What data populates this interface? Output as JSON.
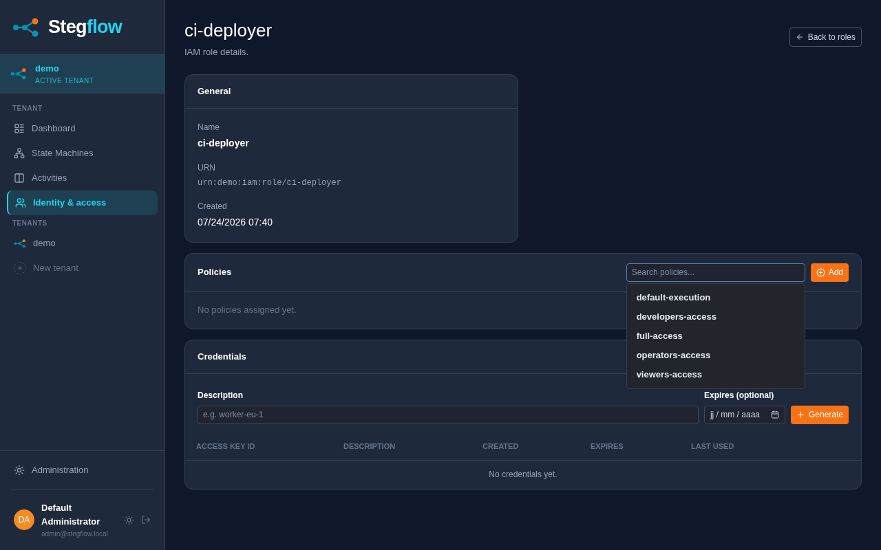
{
  "brand": {
    "first": "Steg",
    "second": "flow"
  },
  "active_tenant": {
    "name": "demo",
    "label": "ACTIVE TENANT"
  },
  "nav_sections": [
    {
      "title": "TENANT",
      "items": [
        {
          "label": "Dashboard",
          "kind": "dashboard",
          "selected": false
        },
        {
          "label": "State Machines",
          "kind": "machines",
          "selected": false
        },
        {
          "label": "Activities",
          "kind": "activities",
          "selected": false
        },
        {
          "label": "Identity & access",
          "kind": "identity",
          "selected": true
        }
      ]
    },
    {
      "title": "TENANTS",
      "items": [
        {
          "label": "demo",
          "kind": "tenant",
          "selected": false
        },
        {
          "label": "New tenant",
          "kind": "new",
          "selected": false
        }
      ]
    }
  ],
  "admin_link": "Administration",
  "user": {
    "initials": "DA",
    "name": "Default Administrator",
    "email": "admin@stegflow.local"
  },
  "page": {
    "title": "ci-deployer",
    "subtitle": "IAM role details.",
    "back": "Back to roles"
  },
  "general": {
    "title": "General",
    "fields": [
      {
        "label": "Name",
        "value": "ci-deployer",
        "kind": "bold"
      },
      {
        "label": "URN",
        "value": "urn:demo:iam:role/ci-deployer",
        "kind": "code"
      },
      {
        "label": "Created",
        "value": "07/24/2026 07:40",
        "kind": "plain"
      }
    ]
  },
  "policies": {
    "title": "Policies",
    "search_placeholder": "Search policies...",
    "add": "Add",
    "empty": "No policies assigned yet.",
    "options": [
      "default-execution",
      "developers-access",
      "full-access",
      "operators-access",
      "viewers-access"
    ]
  },
  "credentials": {
    "title": "Credentials",
    "description_label": "Description",
    "description_placeholder": "e.g. worker-eu-1",
    "expires_label": "Expires (optional)",
    "date_placeholder": "jj / mm / aaaa",
    "generate": "Generate",
    "columns": [
      "ACCESS KEY ID",
      "DESCRIPTION",
      "CREATED",
      "EXPIRES",
      "LAST USED"
    ],
    "empty": "No credentials yet."
  }
}
